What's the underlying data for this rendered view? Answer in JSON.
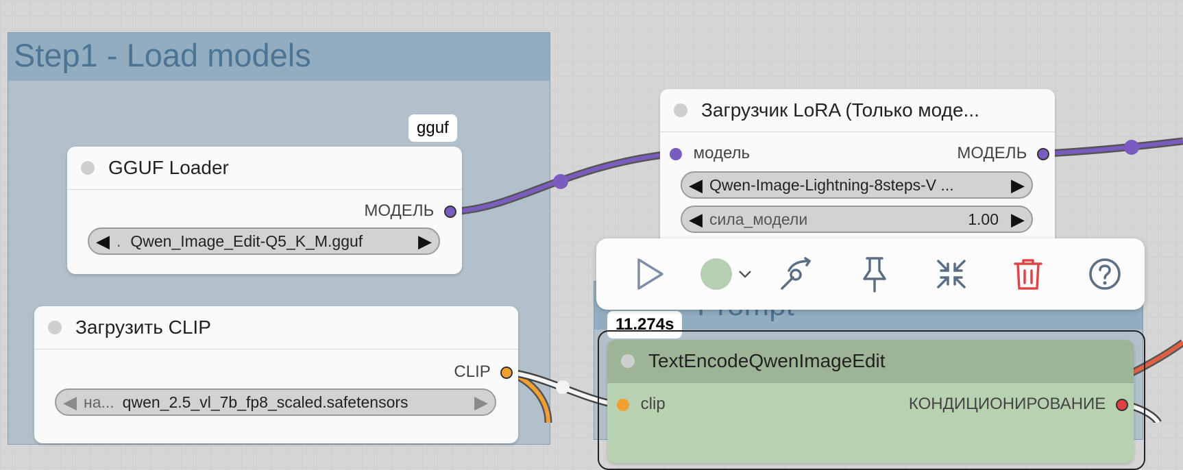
{
  "groups": {
    "step1_title": "Step1 - Load models",
    "step2_title": "Prompt"
  },
  "gguf_loader": {
    "badge": "gguf",
    "title": "GGUF Loader",
    "output_label": "МОДЕЛЬ",
    "widget_prefix": ".",
    "widget_value": "Qwen_Image_Edit-Q5_K_M.gguf"
  },
  "clip_loader": {
    "title": "Загрузить CLIP",
    "output_label": "CLIP",
    "widget_prefix": "на...",
    "widget_value": "qwen_2.5_vl_7b_fp8_scaled.safetensors"
  },
  "lora_loader": {
    "title": "Загрузчик LoRA (Только моде...",
    "input_label": "модель",
    "output_label": "МОДЕЛЬ",
    "lora_value": "Qwen-Image-Lightning-8steps-V ...",
    "strength_label": "сила_модели",
    "strength_value": "1.00"
  },
  "text_encode": {
    "timing_badge": "11.274s",
    "title": "TextEncodeQwenImageEdit",
    "input_label": "clip",
    "output_label": "КОНДИЦИОНИРОВАНИЕ"
  },
  "toolbar": {
    "icons": [
      "play-icon",
      "color-circle-icon",
      "chevron-down-icon",
      "bypass-icon",
      "pin-icon",
      "collapse-icon",
      "trash-icon",
      "help-icon"
    ]
  },
  "colors": {
    "model_link": "#7a5cc0",
    "clip_link": "#f0a030",
    "conditioning_link": "#e06040",
    "node_header_green": "#9db596",
    "node_body_green": "#b8d1b1"
  }
}
